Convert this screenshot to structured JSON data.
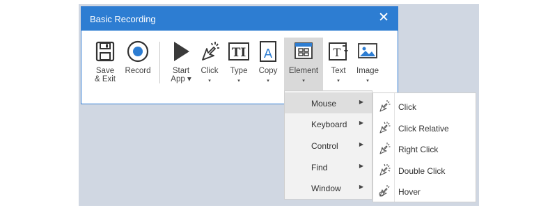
{
  "window": {
    "title": "Basic Recording",
    "close_glyph": "✕"
  },
  "toolbar": {
    "items": [
      {
        "label": "Save\n& Exit",
        "icon": "save-icon"
      },
      {
        "label": "Record",
        "icon": "record-icon"
      },
      {
        "label": "Start\nApp ▾",
        "icon": "start-app-icon"
      },
      {
        "label": "Click",
        "icon": "click-icon",
        "dropdown": "▾"
      },
      {
        "label": "Type",
        "icon": "type-icon",
        "dropdown": "▾"
      },
      {
        "label": "Copy",
        "icon": "copy-icon",
        "dropdown": "▾"
      },
      {
        "label": "Element",
        "icon": "element-icon",
        "dropdown": "▾"
      },
      {
        "label": "Text",
        "icon": "text-icon",
        "dropdown": "▾"
      },
      {
        "label": "Image",
        "icon": "image-icon",
        "dropdown": "▾"
      }
    ]
  },
  "element_menu": {
    "items": [
      {
        "label": "Mouse",
        "arrow": "▶"
      },
      {
        "label": "Keyboard",
        "arrow": "▶"
      },
      {
        "label": "Control",
        "arrow": "▶"
      },
      {
        "label": "Find",
        "arrow": "▶"
      },
      {
        "label": "Window",
        "arrow": "▶"
      }
    ]
  },
  "mouse_submenu": {
    "items": [
      {
        "label": "Click",
        "icon": "click-icon"
      },
      {
        "label": "Click Relative",
        "icon": "click-relative-icon"
      },
      {
        "label": "Right Click",
        "icon": "right-click-icon"
      },
      {
        "label": "Double Click",
        "icon": "double-click-icon"
      },
      {
        "label": "Hover",
        "icon": "hover-icon"
      }
    ]
  },
  "colors": {
    "titlebar": "#2d7dd2",
    "icon_blue": "#2d7dd2",
    "icon_dark": "#333333"
  }
}
